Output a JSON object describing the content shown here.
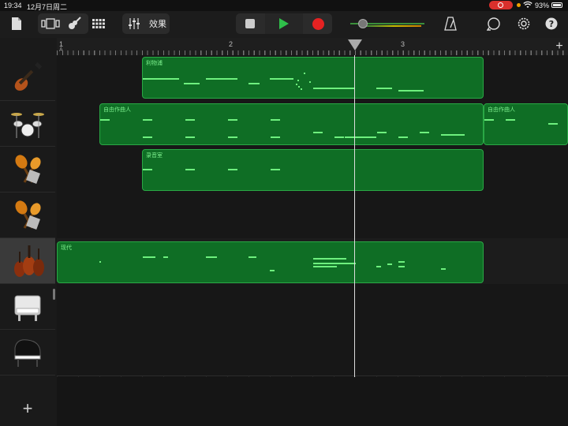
{
  "status_bar": {
    "time": "19:34",
    "date": "12月7日周二",
    "battery": "93%"
  },
  "toolbar": {
    "effects_label": "效果",
    "accent_green": "#2fbf4a",
    "record_red": "#e52222"
  },
  "ruler": {
    "bars": [
      "1",
      "2",
      "3"
    ],
    "marker": "A"
  },
  "tracks": [
    {
      "instrument": "bass-guitar-icon",
      "region_label": "利物浦"
    },
    {
      "instrument": "drum-kit-icon",
      "region_label": "自由作曲人",
      "region2_label": "自由作曲人"
    },
    {
      "instrument": "maracas-icon",
      "region_label": "录音室"
    },
    {
      "instrument": "maracas-icon",
      "region_label": ""
    },
    {
      "instrument": "strings-icon",
      "region_label": "现代"
    },
    {
      "instrument": "electric-piano-icon",
      "region_label": ""
    },
    {
      "instrument": "grand-piano-icon",
      "region_label": ""
    }
  ],
  "add_track_label": "+"
}
